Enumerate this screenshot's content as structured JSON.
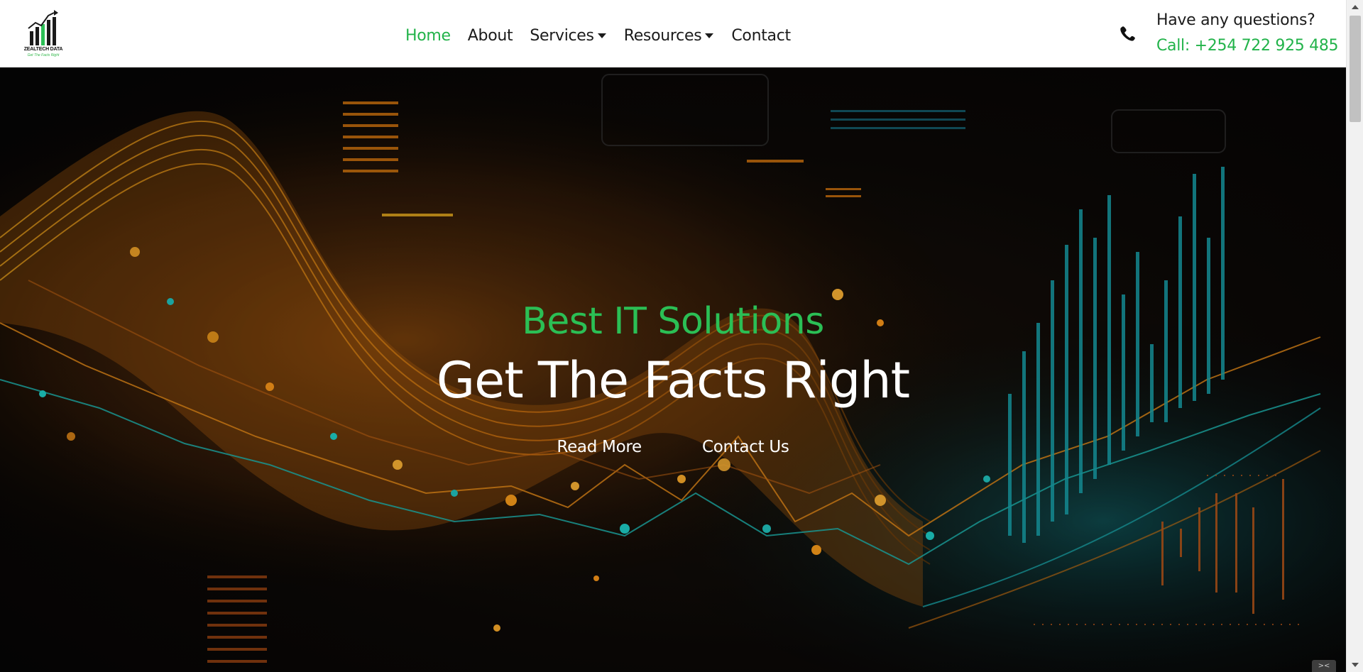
{
  "brand": {
    "name": "ZEALTECH DATA",
    "tagline": "Get The Facts Right",
    "accent_color": "#22b34a"
  },
  "nav": {
    "items": [
      {
        "label": "Home",
        "active": true
      },
      {
        "label": "About",
        "active": false
      },
      {
        "label": "Services",
        "active": false,
        "dropdown": true
      },
      {
        "label": "Resources",
        "active": false,
        "dropdown": true
      },
      {
        "label": "Contact",
        "active": false
      }
    ]
  },
  "contact": {
    "icon": "phone-icon",
    "question": "Have any questions?",
    "call": "Call: +254 722 925 485"
  },
  "hero": {
    "subtitle": "Best IT Solutions",
    "title": "Get The Facts Right",
    "buttons": [
      {
        "label": "Read More"
      },
      {
        "label": "Contact Us"
      }
    ]
  },
  "colors": {
    "subtitle": "#2bbf55",
    "title": "#ffffff",
    "glow_orange": "#f5a21b",
    "glow_teal": "#1fb5b0"
  }
}
